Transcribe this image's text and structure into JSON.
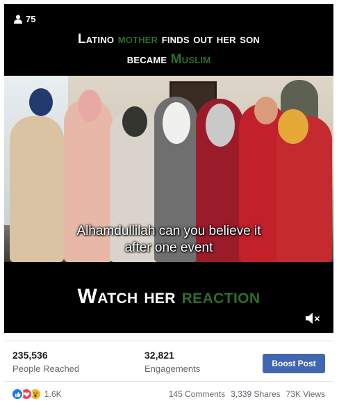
{
  "video": {
    "viewers_count": "75",
    "headline_part1": "Latino ",
    "headline_highlight1": "mother",
    "headline_part2": " finds out her son",
    "headline_part3": "became ",
    "headline_highlight2": "Muslim",
    "caption_line1": "Alhamdullilah can you believe it",
    "caption_line2": "after one event",
    "reaction_part1": "Watch her ",
    "reaction_highlight": "reaction",
    "highlight_color": "#2f6b2a",
    "mute_icon": "speaker-muted-icon"
  },
  "stats": {
    "people_reached_value": "235,536",
    "people_reached_label": "People Reached",
    "engagements_value": "32,821",
    "engagements_label": "Engagements",
    "boost_label": "Boost Post",
    "boost_color": "#4267b2"
  },
  "footer": {
    "reaction_icons": [
      "like-icon",
      "love-icon",
      "wow-icon"
    ],
    "reaction_count": "1.6K",
    "comments": "145 Comments",
    "shares": "3,339 Shares",
    "views": "73K Views"
  }
}
